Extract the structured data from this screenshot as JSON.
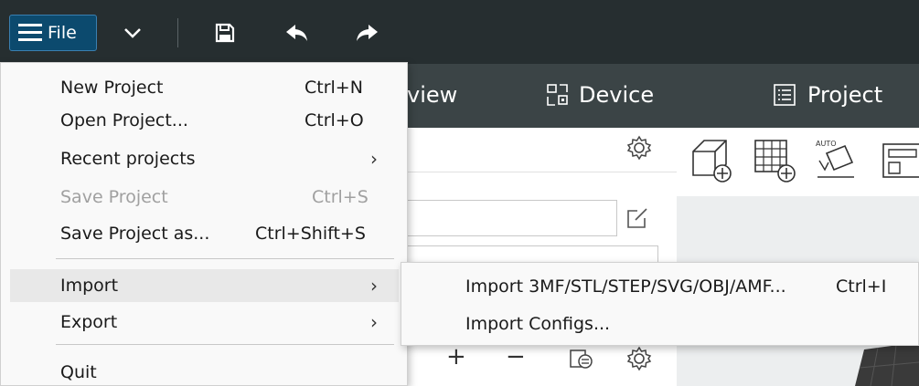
{
  "titlebar": {
    "file_label": "File",
    "icons": [
      "menu-icon",
      "chevron-down-icon",
      "save-icon",
      "undo-icon",
      "redo-icon"
    ]
  },
  "tabs": [
    {
      "label": "view",
      "icon": "preview-icon"
    },
    {
      "label": "Device",
      "icon": "device-icon"
    },
    {
      "label": "Project",
      "icon": "project-icon"
    }
  ],
  "file_menu": {
    "items": [
      {
        "label": "New Project",
        "shortcut": "Ctrl+N"
      },
      {
        "label": "Open Project...",
        "shortcut": "Ctrl+O"
      },
      {
        "label": "Recent projects",
        "submenu": true
      },
      {
        "label": "Save Project",
        "shortcut": "Ctrl+S",
        "disabled": true
      },
      {
        "label": "Save Project as...",
        "shortcut": "Ctrl+Shift+S"
      },
      {
        "label": "Import",
        "submenu": true,
        "highlighted": true
      },
      {
        "label": "Export",
        "submenu": true
      },
      {
        "label": "Quit"
      }
    ]
  },
  "import_submenu": {
    "items": [
      {
        "label": "Import 3MF/STL/STEP/SVG/OBJ/AMF...",
        "shortcut": "Ctrl+I"
      },
      {
        "label": "Import Configs..."
      }
    ]
  },
  "colors": {
    "titlebar_bg": "#262e30",
    "file_button_bg": "#0c4a6e",
    "tabbar_bg": "#3b4446",
    "menu_bg": "#f9f9f9",
    "highlight_bg": "#e8e8e8"
  }
}
